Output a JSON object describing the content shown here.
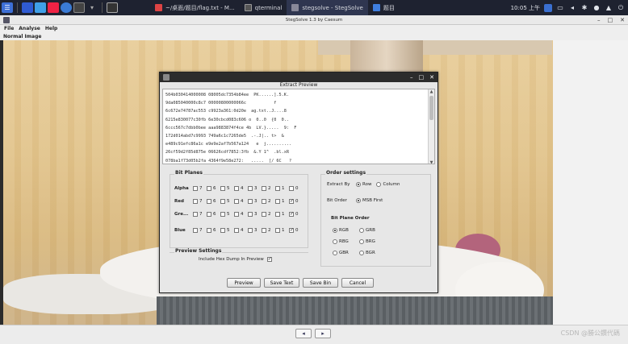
{
  "taskbar": {
    "tasks": [
      {
        "label": "~/桌面/题目/flag.txt - M...",
        "active": false
      },
      {
        "label": "qterminal",
        "active": false
      },
      {
        "label": "stegsolve - StegSolve",
        "active": true
      },
      {
        "label": "题目",
        "active": false
      }
    ],
    "clock": "10:05 上午"
  },
  "window": {
    "title": "StegSolve 1.3 by Caesum",
    "menu": [
      "File",
      "Analyse",
      "Help"
    ],
    "view_label": "Normal Image"
  },
  "dialog": {
    "title": "Extract Preview",
    "preview_lines": [
      "504b030414000008 08005dc7354b84ee  PK......].5.K.",
      "9da085040000c8c7 00000800000066c           f",
      "6c672e74787ac553 c9923a361:0d20e  ag.txt..J....8",
      "6215e830077c30fb 6e30cbcd083c606 o  0..0  {0  0..",
      "6ccc567c7dbb0bee aaa9883874f4ce 4b  LV.}.....  9:  F",
      "172d014abd7c9993 749a6c1c7265de5  .-.J|.. t>  &",
      "e489c91efc86a1c e9e9e2af7b567a124   e  j..........",
      "26cf59d2f85d875e 06626cdf7852:3fb  &.Y 1^  .bl.xR",
      "078ba1f73d05b2fa 4364f9e58e272:   .....  [/ 6C   ?",
      "f1c2d7a18eb7558a 6751 acbd4^a38e4e        t. gQ  O..N"
    ],
    "bit_planes_label": "Bit Planes",
    "planes": [
      {
        "name": "Alpha",
        "checked": [
          false,
          false,
          false,
          false,
          false,
          false,
          false,
          false
        ]
      },
      {
        "name": "Red",
        "checked": [
          false,
          false,
          false,
          false,
          false,
          false,
          false,
          true
        ]
      },
      {
        "name": "Gre...",
        "checked": [
          false,
          false,
          false,
          false,
          false,
          false,
          false,
          true
        ]
      },
      {
        "name": "Blue",
        "checked": [
          false,
          false,
          false,
          false,
          false,
          false,
          false,
          true
        ]
      }
    ],
    "bits": [
      "7",
      "6",
      "5",
      "4",
      "3",
      "2",
      "1",
      "0"
    ],
    "order_settings_label": "Order settings",
    "extract_by_label": "Extract By",
    "extract_by_options": [
      "Row",
      "Column"
    ],
    "extract_by_selected": "Row",
    "bit_order_label": "Bit Order",
    "bit_order_options": [
      "MSB First"
    ],
    "bit_order_selected": "MSB First",
    "bit_plane_order_label": "Bit Plane Order",
    "plane_orders": [
      "RGB",
      "GRB",
      "RBG",
      "BRG",
      "GBR",
      "BGR"
    ],
    "plane_order_selected": "RGB",
    "preview_settings_label": "Preview Settings",
    "hex_dump_label": "Include Hex Dump In Preview",
    "hex_dump_checked": true,
    "buttons": [
      "Preview",
      "Save Text",
      "Save Bin",
      "Cancel"
    ]
  },
  "watermark": "CSDN @勝公鑽代碼"
}
